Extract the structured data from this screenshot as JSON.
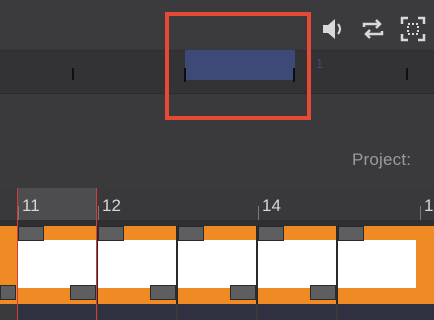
{
  "toolbar": {
    "icons": [
      "speaker-icon",
      "loop-icon",
      "fit-screen-icon"
    ]
  },
  "overview": {
    "marker_label": "1"
  },
  "panel": {
    "project_label": "Project:"
  },
  "ruler": {
    "labels": [
      "11",
      "12",
      "14",
      "1"
    ]
  },
  "colors": {
    "clip_orange": "#f08a24",
    "overview_window": "#3d4a78",
    "highlight": "#e54a36",
    "playhead": "#d23c3c"
  }
}
